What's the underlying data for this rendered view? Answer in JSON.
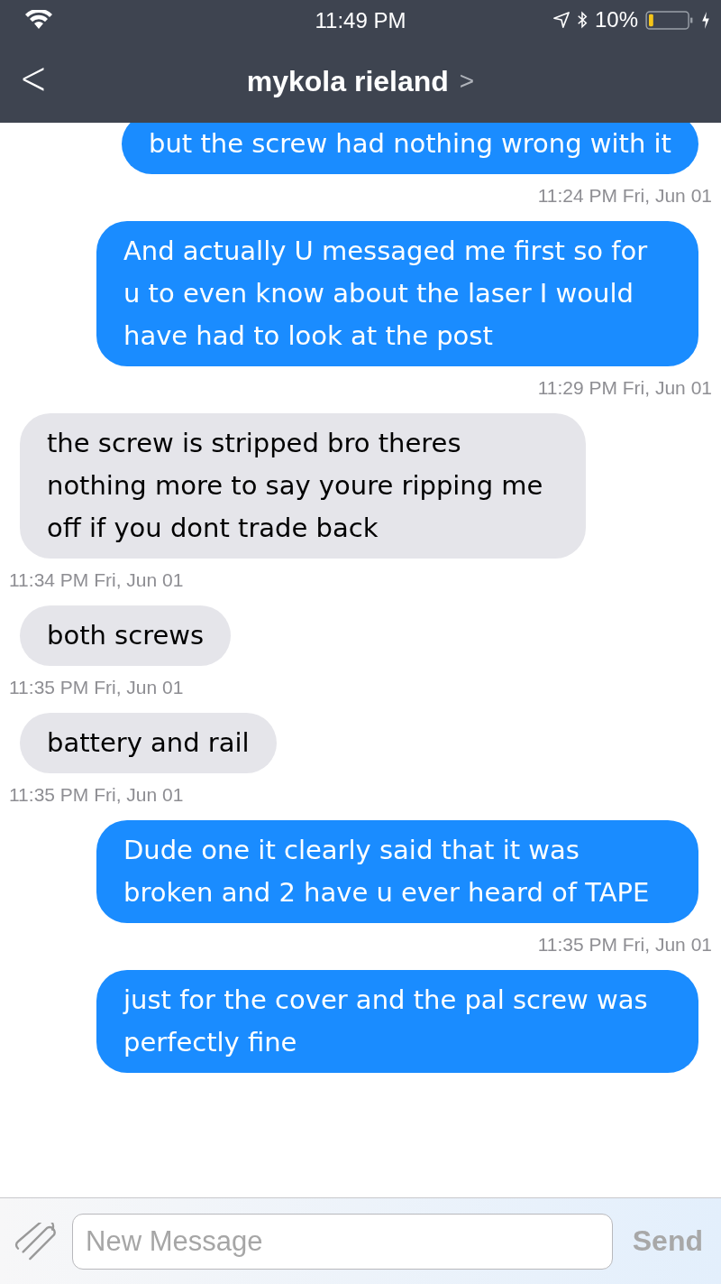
{
  "status_bar": {
    "time": "11:49 PM",
    "battery": "10%"
  },
  "header": {
    "back": "<",
    "title": "mykola rieland",
    "chevron": ">"
  },
  "messages": [
    {
      "kind": "sent",
      "text": "but the screw had nothing wrong with it",
      "time": "11:24 PM Fri, Jun 01"
    },
    {
      "kind": "sent",
      "text": "And actually U messaged me first so for u to even know about the laser I would have had to look at the post",
      "time": "11:29 PM Fri, Jun 01"
    },
    {
      "kind": "received",
      "text": "the screw is stripped bro theres nothing more to say youre ripping me off if you dont trade back",
      "time": "11:34 PM Fri, Jun 01"
    },
    {
      "kind": "received",
      "text": "both screws",
      "time": "11:35 PM Fri, Jun 01"
    },
    {
      "kind": "received",
      "text": "battery and rail",
      "time": "11:35 PM Fri, Jun 01"
    },
    {
      "kind": "sent",
      "text": "Dude one it clearly said that it was broken and 2 have u ever heard of TAPE",
      "time": "11:35 PM Fri, Jun 01"
    },
    {
      "kind": "sent",
      "text": "just for the cover and the pal screw was perfectly fine"
    }
  ],
  "composer": {
    "placeholder": "New Message",
    "send": "Send",
    "send_disabled": true
  }
}
